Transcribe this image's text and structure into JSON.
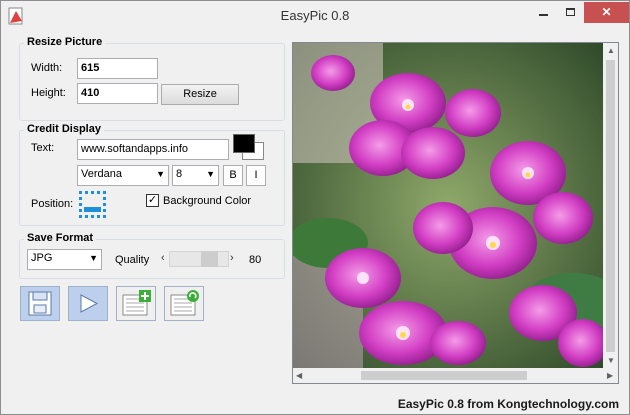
{
  "window": {
    "title": "EasyPic 0.8"
  },
  "resize": {
    "title": "Resize Picture",
    "width_label": "Width:",
    "width_value": "615",
    "height_label": "Height:",
    "height_value": "410",
    "resize_button": "Resize"
  },
  "credit": {
    "title": "Credit Display",
    "text_label": "Text:",
    "text_value": "www.softandapps.info",
    "font": "Verdana",
    "size": "8",
    "bold_label": "B",
    "italic_label": "I",
    "position_label": "Position:",
    "bg_color_label": "Background Color",
    "bg_color_checked": true,
    "fg_color": "#000000",
    "bg_color": "#ffffff"
  },
  "save": {
    "title": "Save Format",
    "format": "JPG",
    "quality_label": "Quality",
    "quality_value": "80"
  },
  "footer": "EasyPic 0.8 from Kongtechnology.com"
}
